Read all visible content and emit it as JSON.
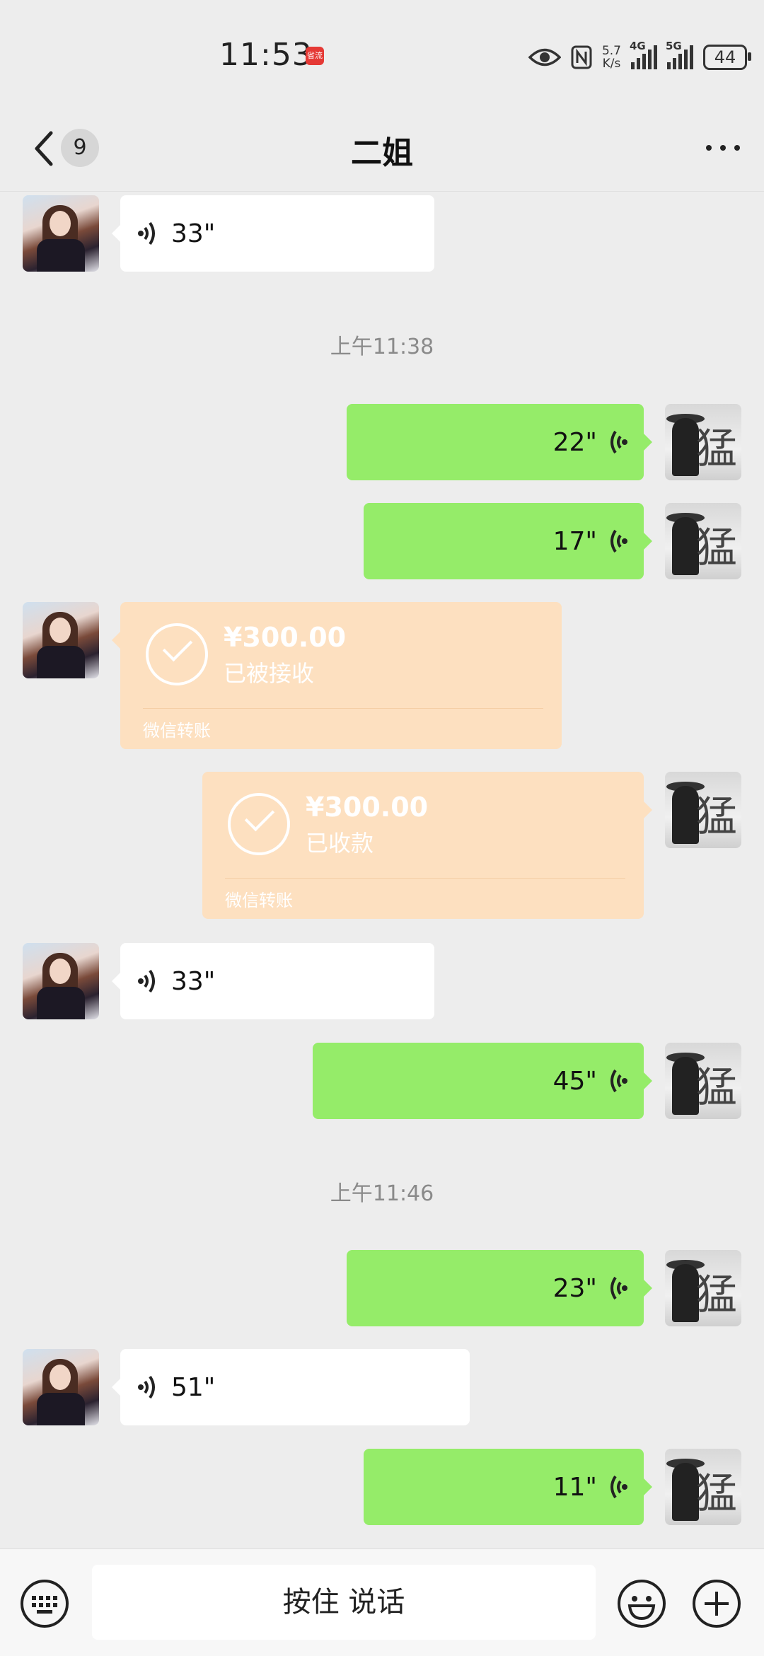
{
  "status_bar": {
    "time": "11:53",
    "badge": "省流",
    "net_speed_value": "5.7",
    "net_speed_unit": "K/s",
    "sig1_label": "4G",
    "sig2_label": "5G",
    "battery": "44"
  },
  "header": {
    "unread_count": "9",
    "title": "二姐"
  },
  "timestamps": [
    "上午11:38",
    "上午11:46"
  ],
  "messages": {
    "v1": "33\"",
    "v2": "22\"",
    "v3": "17\"",
    "t1": {
      "amount": "¥300.00",
      "status": "已被接收",
      "label": "微信转账"
    },
    "t2": {
      "amount": "¥300.00",
      "status": "已收款",
      "label": "微信转账"
    },
    "v4": "33\"",
    "v5": "45\"",
    "v6": "23\"",
    "v7": "51\"",
    "v8": "11\""
  },
  "input_bar": {
    "hold_to_talk": "按住 说话"
  },
  "colors": {
    "background": "#ededed",
    "outgoing_bubble": "#95ec69",
    "incoming_bubble": "#ffffff",
    "transfer_card": "#fde0c0"
  },
  "avatar_him_glyph": "猛"
}
